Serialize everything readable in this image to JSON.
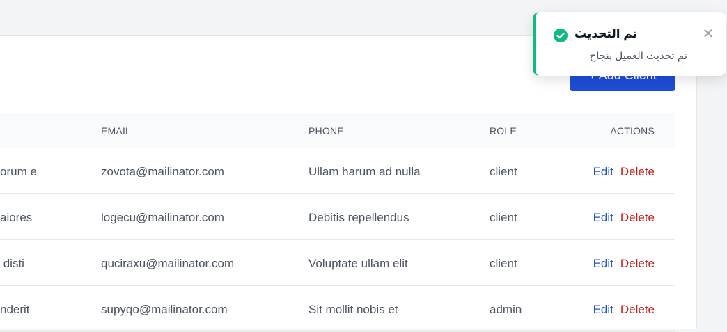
{
  "header": {
    "add_client_label": "+ Add Client"
  },
  "table": {
    "columns": {
      "email": "EMAIL",
      "phone": "PHONE",
      "role": "ROLE",
      "actions": "ACTIONS"
    },
    "rows": [
      {
        "name_fragment": "orum e",
        "email": "zovota@mailinator.com",
        "phone": "Ullam harum ad nulla",
        "role": "client"
      },
      {
        "name_fragment": "aiores",
        "email": "logecu@mailinator.com",
        "phone": "Debitis repellendus",
        "role": "client"
      },
      {
        "name_fragment": " disti",
        "email": "quciraxu@mailinator.com",
        "phone": "Voluptate ullam elit",
        "role": "client"
      },
      {
        "name_fragment": "nderit",
        "email": "supyqo@mailinator.com",
        "phone": "Sit mollit nobis et",
        "role": "admin"
      }
    ],
    "edit_label": "Edit",
    "delete_label": "Delete"
  },
  "toast": {
    "title": "تم التحديث",
    "message": "تم تحديث العميل بنجاح",
    "close_symbol": "✕",
    "status_color": "#10b981",
    "icon": "check-circle-icon"
  },
  "colors": {
    "primary": "#1d4ed8",
    "danger": "#c81e1e"
  }
}
